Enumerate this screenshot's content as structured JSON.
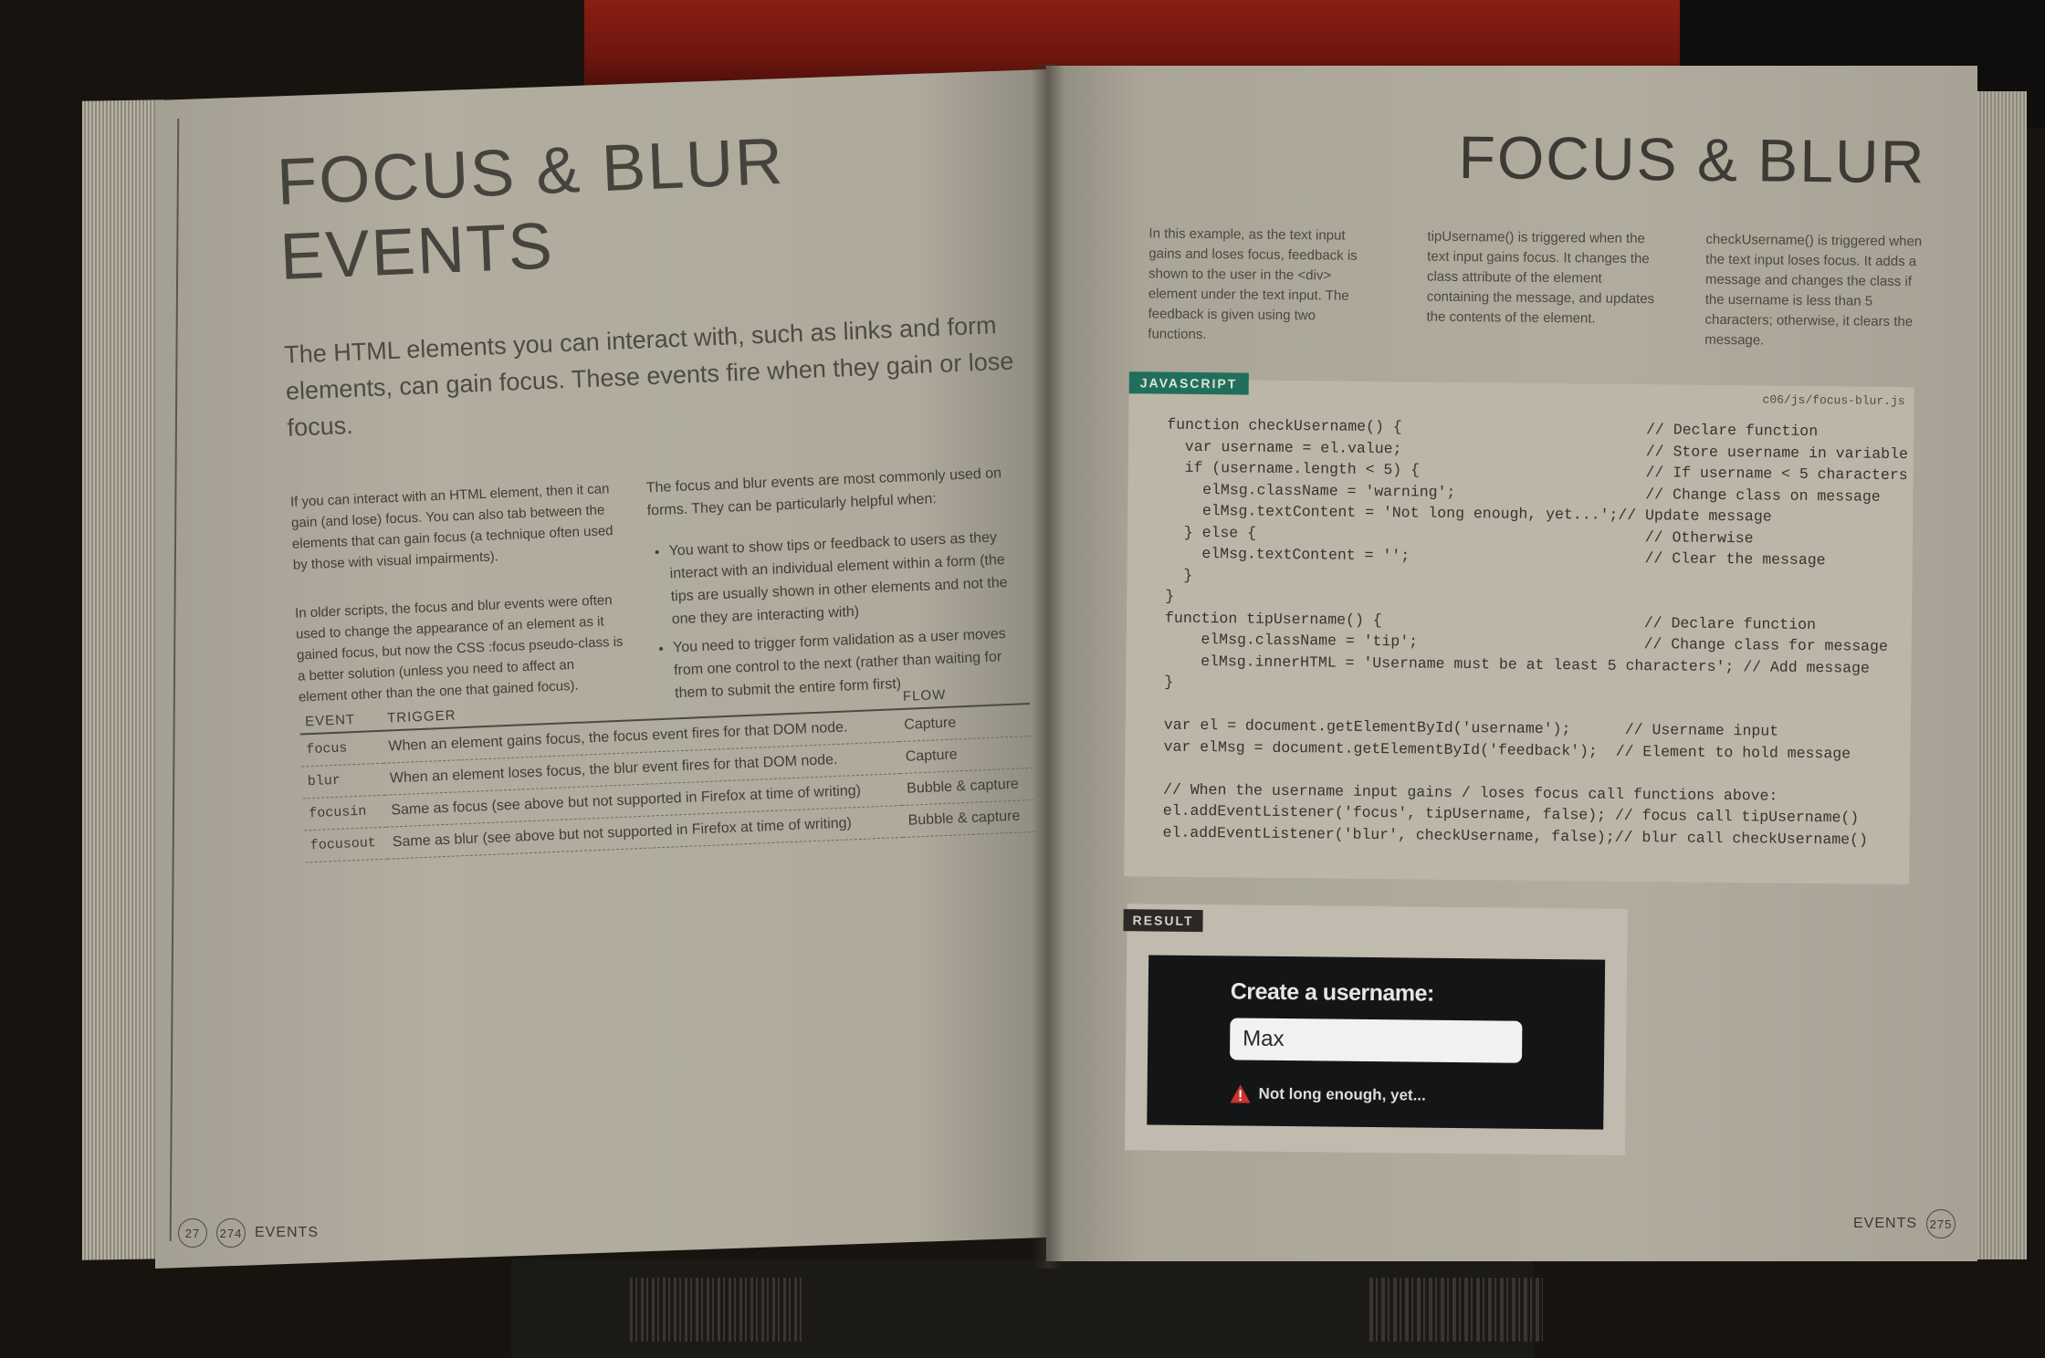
{
  "left_page": {
    "title": "FOCUS & BLUR EVENTS",
    "intro": "The HTML elements you can interact with, such as links and form elements, can gain focus. These events fire when they gain or lose focus.",
    "col_a": [
      "If you can interact with an HTML element, then it can gain (and lose) focus. You can also tab between the elements that can gain focus (a technique often used by those with visual impairments).",
      "In older scripts, the focus and blur events were often used to change the appearance of an element as it gained focus, but now the CSS :focus pseudo-class is a better solution (unless you need to affect an element other than the one that gained focus)."
    ],
    "col_b_intro": "The focus and blur events are most commonly used on forms. They can be particularly helpful when:",
    "col_b_bullets": [
      "You want to show tips or feedback to users as they interact with an individual element within a form (the tips are usually shown in other elements and not the one they are interacting with)",
      "You need to trigger form validation as a user moves from one control to the next (rather than waiting for them to submit the entire form first)"
    ],
    "table": {
      "headers": [
        "EVENT",
        "TRIGGER",
        "FLOW"
      ],
      "rows": [
        {
          "event": "focus",
          "trigger": "When an element gains focus, the focus event fires for that DOM node.",
          "flow": "Capture"
        },
        {
          "event": "blur",
          "trigger": "When an element loses focus, the blur event fires for that DOM node.",
          "flow": "Capture"
        },
        {
          "event": "focusin",
          "trigger": "Same as focus (see above but not supported in Firefox at time of writing)",
          "flow": "Bubble & capture"
        },
        {
          "event": "focusout",
          "trigger": "Same as blur (see above but not supported in Firefox at time of writing)",
          "flow": "Bubble & capture"
        }
      ]
    },
    "footer": {
      "chapter": "27",
      "page": "274",
      "label": "EVENTS"
    }
  },
  "right_page": {
    "title": "FOCUS & BLUR",
    "info_cols": [
      "In this example, as the text input gains and loses focus, feedback is shown to the user in the <div> element under the text input. The feedback is given using two functions.",
      "tipUsername() is triggered when the text input gains focus. It changes the class attribute of the element containing the message, and updates the contents of the element.",
      "checkUsername() is triggered when the text input loses focus. It adds a message and changes the class if the username is less than 5 characters; otherwise, it clears the message."
    ],
    "js_label": "JAVASCRIPT",
    "js_file": "c06/js/focus-blur.js",
    "code": "function checkUsername() {                           // Declare function\n  var username = el.value;                           // Store username in variable\n  if (username.length < 5) {                         // If username < 5 characters\n    elMsg.className = 'warning';                     // Change class on message\n    elMsg.textContent = 'Not long enough, yet...';// Update message\n  } else {                                           // Otherwise\n    elMsg.textContent = '';                          // Clear the message\n  }\n}\nfunction tipUsername() {                             // Declare function\n    elMsg.className = 'tip';                         // Change class for message\n    elMsg.innerHTML = 'Username must be at least 5 characters'; // Add message\n}\n\nvar el = document.getElementById('username');      // Username input\nvar elMsg = document.getElementById('feedback');  // Element to hold message\n\n// When the username input gains / loses focus call functions above:\nel.addEventListener('focus', tipUsername, false); // focus call tipUsername()\nel.addEventListener('blur', checkUsername, false);// blur call checkUsername()",
    "result_label": "RESULT",
    "result": {
      "heading": "Create a username:",
      "input_value": "Max",
      "warning": "Not long enough, yet...",
      "warning_icon": "warning-triangle-icon"
    },
    "footer": {
      "label": "EVENTS",
      "page": "275"
    }
  },
  "colors": {
    "js_label_bg": "#1f6f5b",
    "result_box_bg": "#141517",
    "warning_icon": "#c8352a"
  }
}
